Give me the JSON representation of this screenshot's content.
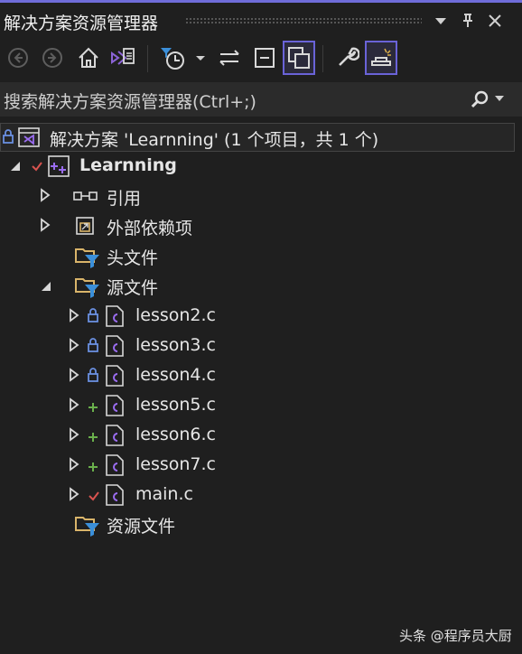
{
  "title": "解决方案资源管理器",
  "title_buttons": {
    "dropdown": "dropdown-icon",
    "pin": "pin-icon",
    "close": "close-icon"
  },
  "search": {
    "placeholder": "搜索解决方案资源管理器(Ctrl+;)"
  },
  "solution": {
    "label": "解决方案 'Learnning' (1 个项目，共 1 个)"
  },
  "project": {
    "label": "Learnning"
  },
  "tree": [
    {
      "label": "引用",
      "kind": "references"
    },
    {
      "label": "外部依赖项",
      "kind": "external"
    },
    {
      "label": "头文件",
      "kind": "filter"
    },
    {
      "label": "源文件",
      "kind": "filter"
    },
    {
      "label": "lesson2.c",
      "status": "lock"
    },
    {
      "label": "lesson3.c",
      "status": "lock"
    },
    {
      "label": "lesson4.c",
      "status": "lock"
    },
    {
      "label": "lesson5.c",
      "status": "add"
    },
    {
      "label": "lesson6.c",
      "status": "add"
    },
    {
      "label": "lesson7.c",
      "status": "add"
    },
    {
      "label": "main.c",
      "status": "check"
    },
    {
      "label": "资源文件",
      "kind": "filter"
    }
  ],
  "watermark": "头条 @程序员大厨",
  "colors": {
    "accent": "#6f6cd9",
    "lock": "#6a8fe0",
    "add": "#6ab04c",
    "check": "#d9534f",
    "folder": "#d9b46a",
    "filter": "#3b8fd9"
  }
}
